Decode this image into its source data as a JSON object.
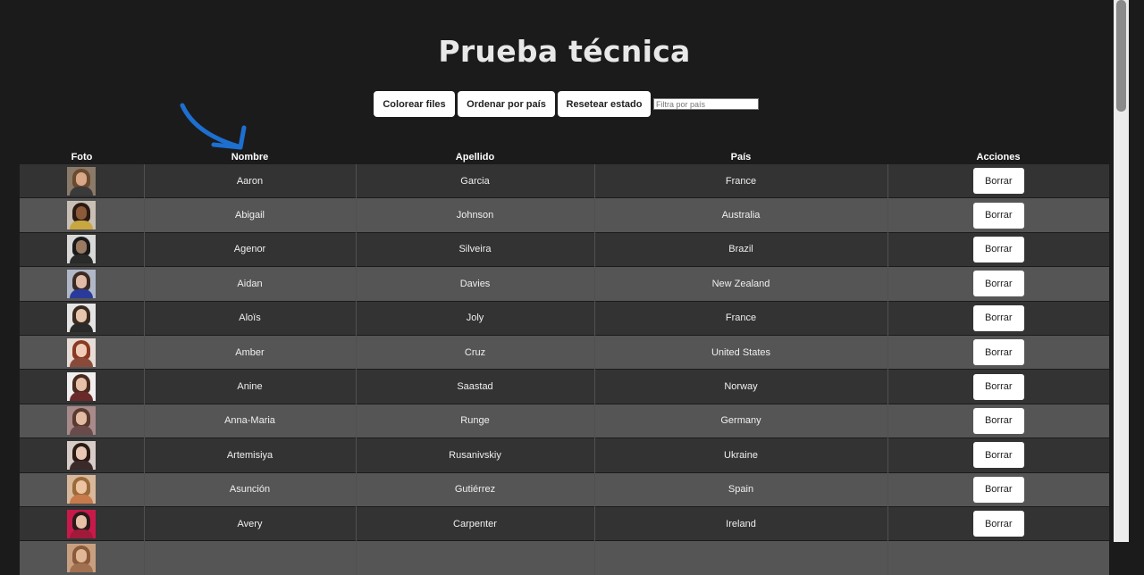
{
  "page": {
    "title": "Prueba técnica"
  },
  "controls": {
    "color_rows_label": "Colorear files",
    "sort_country_label": "Ordenar por país",
    "reset_label": "Resetear estado",
    "filter_placeholder": "Filtra por país"
  },
  "table": {
    "headers": {
      "photo": "Foto",
      "first_name": "Nombre",
      "last_name": "Apellido",
      "country": "País",
      "actions": "Acciones"
    },
    "rows": [
      {
        "first_name": "Aaron",
        "last_name": "Garcia",
        "country": "France",
        "delete_label": "Borrar",
        "avatar": {
          "bg": "#8a7a6a",
          "hair": "#6b4a2e",
          "face": "#d9a88a",
          "body": "#3a3a3a"
        }
      },
      {
        "first_name": "Abigail",
        "last_name": "Johnson",
        "country": "Australia",
        "delete_label": "Borrar",
        "avatar": {
          "bg": "#c9c0b5",
          "hair": "#2a1a12",
          "face": "#8a5a3a",
          "body": "#c8a640"
        }
      },
      {
        "first_name": "Agenor",
        "last_name": "Silveira",
        "country": "Brazil",
        "delete_label": "Borrar",
        "avatar": {
          "bg": "#d8d8d8",
          "hair": "#1a1a1a",
          "face": "#9a7a62",
          "body": "#2a2a2a"
        }
      },
      {
        "first_name": "Aidan",
        "last_name": "Davies",
        "country": "New Zealand",
        "delete_label": "Borrar",
        "avatar": {
          "bg": "#b0b8c8",
          "hair": "#3a2a22",
          "face": "#e0bca8",
          "body": "#2a3a9a"
        }
      },
      {
        "first_name": "Aloïs",
        "last_name": "Joly",
        "country": "France",
        "delete_label": "Borrar",
        "avatar": {
          "bg": "#e4e4e4",
          "hair": "#3a2a1e",
          "face": "#e6c4ae",
          "body": "#2a2a2a"
        }
      },
      {
        "first_name": "Amber",
        "last_name": "Cruz",
        "country": "United States",
        "delete_label": "Borrar",
        "avatar": {
          "bg": "#e8dcd6",
          "hair": "#8a3a22",
          "face": "#f0cdb8",
          "body": "#8a4a3a"
        }
      },
      {
        "first_name": "Anine",
        "last_name": "Saastad",
        "country": "Norway",
        "delete_label": "Borrar",
        "avatar": {
          "bg": "#f0eeee",
          "hair": "#4a2a1e",
          "face": "#e6c0a8",
          "body": "#6a2a2a"
        }
      },
      {
        "first_name": "Anna-Maria",
        "last_name": "Runge",
        "country": "Germany",
        "delete_label": "Borrar",
        "avatar": {
          "bg": "#a88a8a",
          "hair": "#5a3a2e",
          "face": "#e4bca4",
          "body": "#6a4a4a"
        }
      },
      {
        "first_name": "Artemisiya",
        "last_name": "Rusanivskiy",
        "country": "Ukraine",
        "delete_label": "Borrar",
        "avatar": {
          "bg": "#d8ccc8",
          "hair": "#2a1a14",
          "face": "#e8c8b4",
          "body": "#3a2a2a"
        }
      },
      {
        "first_name": "Asunción",
        "last_name": "Gutiérrez",
        "country": "Spain",
        "delete_label": "Borrar",
        "avatar": {
          "bg": "#d8b89a",
          "hair": "#9a6a3a",
          "face": "#ecc4a2",
          "body": "#c87a4a"
        }
      },
      {
        "first_name": "Avery",
        "last_name": "Carpenter",
        "country": "Ireland",
        "delete_label": "Borrar",
        "avatar": {
          "bg": "#c81a4a",
          "hair": "#2a1a1a",
          "face": "#e8c0a8",
          "body": "#a01a3a"
        }
      },
      {
        "first_name": "",
        "last_name": "",
        "country": "",
        "delete_label": "",
        "avatar": {
          "bg": "#c8a080",
          "hair": "#8a5a3a",
          "face": "#e0b898",
          "body": "#a07050"
        }
      }
    ]
  },
  "colors": {
    "background": "#1c1b1c",
    "row_dark": "#333333",
    "row_light": "#555555",
    "annotation_arrow": "#1d6fd0"
  }
}
